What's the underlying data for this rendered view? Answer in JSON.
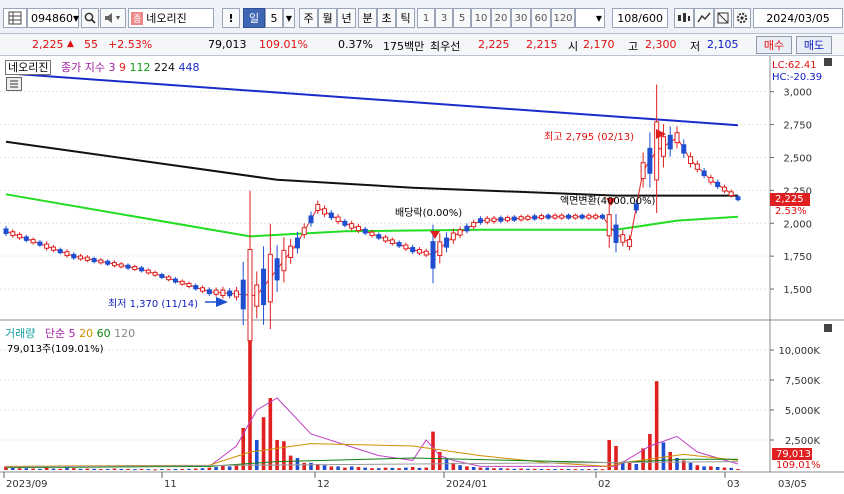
{
  "toolbar": {
    "code": "094860",
    "stock_name": "네오리진",
    "interval_buttons": [
      "일",
      "5",
      "주",
      "월",
      "년",
      "분",
      "초",
      "틱"
    ],
    "period_buttons": [
      "1",
      "3",
      "5",
      "10",
      "20",
      "30",
      "60",
      "120"
    ],
    "count": "108/600",
    "date": "2024/03/05"
  },
  "quote": {
    "price": "2,225",
    "change": "55",
    "change_pct": "+2.53%",
    "volume": "79,013",
    "volume_ratio": "109.01%",
    "turnover": "0.37%",
    "value_label": "175백만",
    "best_ask_label": "최우선",
    "best_ask": "2,225",
    "best_bid": "2,215",
    "open_label": "시",
    "open": "2,170",
    "high_label": "고",
    "high": "2,300",
    "low_label": "저",
    "low": "2,105",
    "buy_label": "매수",
    "sell_label": "매도"
  },
  "price_panel": {
    "name_tag": "네오리진",
    "ma_title": "종가 지수 3",
    "ma_periods": [
      "9",
      "112",
      "224",
      "448"
    ],
    "lc_label": "LC:62.41",
    "hc_label": "HC:-20.39",
    "high_note": "최고 2,795 (02/13)",
    "low_note": "최저 1,370 (11/14)",
    "dividend_note": "배당락(0.00%)",
    "par_change_note": "액면변환(4000.00%)",
    "current_price": "2,225",
    "current_pct": "2.53%"
  },
  "volume_panel": {
    "title": "거래량",
    "ma_title": "단순 5",
    "ma_periods": [
      "20",
      "60",
      "120"
    ],
    "volume_note": "79,013주(109.01%)",
    "current_volume": "79,013",
    "current_pct": "109.01%"
  },
  "colors": {
    "up": "#e02020",
    "down": "#1f4fd0",
    "ma9": "#e02020",
    "ma112": "#22dd22",
    "ma224": "#111111",
    "ma448": "#1a2cc8",
    "accent": "#3f66b3"
  },
  "chart_data": [
    {
      "type": "candlestick",
      "y_axis_ticks": [
        "3,000",
        "2,750",
        "2,500",
        "2,250",
        "2,000",
        "1,750",
        "1,500"
      ],
      "ylim": [
        1280,
        3180
      ],
      "grid": true,
      "x_axis_labels": [
        "2023/09",
        "11",
        "12",
        "2024/01",
        "02",
        "03",
        "03/05"
      ],
      "series": [
        {
          "name": "448",
          "x": [
            0,
            108
          ],
          "values": [
            3140,
            2745
          ]
        },
        {
          "name": "224",
          "x": [
            0,
            40,
            60,
            90,
            108
          ],
          "values": [
            2620,
            2330,
            2270,
            2210,
            2210
          ]
        },
        {
          "name": "112",
          "x": [
            0,
            36,
            50,
            70,
            90,
            99,
            108
          ],
          "values": [
            2220,
            1900,
            1940,
            1950,
            1950,
            2020,
            2050
          ]
        },
        {
          "name": "9",
          "x": [
            0,
            10,
            20,
            30,
            37,
            40,
            43,
            46,
            50,
            55,
            60,
            63,
            66,
            70,
            80,
            88,
            90,
            92,
            94,
            96,
            99,
            101,
            104,
            108
          ],
          "values": [
            1940,
            1750,
            1650,
            1480,
            1450,
            1650,
            1850,
            2120,
            2000,
            1900,
            1800,
            1760,
            1900,
            2020,
            2050,
            2050,
            1920,
            1850,
            2400,
            2550,
            2650,
            2480,
            2330,
            2190
          ]
        }
      ]
    },
    {
      "type": "bar",
      "y_axis_ticks": [
        "10,000K",
        "7,500K",
        "5,000K",
        "2,500K"
      ],
      "ylim": [
        0,
        11000000
      ],
      "grid": true,
      "categories": [
        0,
        1,
        2,
        3,
        4,
        5,
        6,
        7,
        8,
        9,
        10,
        11,
        12,
        13,
        14,
        15,
        16,
        17,
        18,
        19,
        20,
        21,
        22,
        23,
        24,
        25,
        26,
        27,
        28,
        29,
        30,
        31,
        32,
        33,
        34,
        35,
        36,
        37,
        38,
        39,
        40,
        41,
        42,
        43,
        44,
        45,
        46,
        47,
        48,
        49,
        50,
        51,
        52,
        53,
        54,
        55,
        56,
        57,
        58,
        59,
        60,
        61,
        62,
        63,
        64,
        65,
        66,
        67,
        68,
        69,
        70,
        71,
        72,
        73,
        74,
        75,
        76,
        77,
        78,
        79,
        80,
        81,
        82,
        83,
        84,
        85,
        86,
        87,
        88,
        89,
        90,
        91,
        92,
        93,
        94,
        95,
        96,
        97,
        98,
        99,
        100,
        101,
        102,
        103,
        104,
        105,
        106,
        107
      ],
      "values": [
        300000,
        200000,
        150000,
        150000,
        120000,
        100000,
        250000,
        120000,
        100000,
        200000,
        150000,
        100000,
        120000,
        100000,
        80000,
        90000,
        120000,
        90000,
        80000,
        70000,
        90000,
        70000,
        60000,
        80000,
        70000,
        90000,
        80000,
        100000,
        120000,
        150000,
        200000,
        250000,
        400000,
        300000,
        500000,
        3500000,
        11800000,
        2500000,
        4400000,
        6000000,
        2500000,
        2400000,
        1200000,
        1000000,
        600000,
        600000,
        500000,
        400000,
        300000,
        300000,
        200000,
        300000,
        250000,
        200000,
        150000,
        150000,
        200000,
        180000,
        150000,
        200000,
        250000,
        180000,
        200000,
        3200000,
        1500000,
        900000,
        600000,
        400000,
        300000,
        250000,
        200000,
        200000,
        150000,
        150000,
        120000,
        100000,
        120000,
        100000,
        100000,
        80000,
        80000,
        80000,
        80000,
        80000,
        70000,
        70000,
        80000,
        70000,
        70000,
        2500000,
        2000000,
        700000,
        600000,
        500000,
        1800000,
        3000000,
        7400000,
        2300000,
        1500000,
        1000000,
        800000,
        600000,
        400000,
        300000,
        300000,
        250000,
        200000,
        180000,
        79013
      ],
      "series": [
        {
          "name": "5",
          "x": [
            30,
            34,
            37,
            40,
            45,
            55,
            60,
            62,
            64,
            66,
            70,
            90,
            95,
            99,
            102,
            108
          ],
          "values": [
            300000,
            2000000,
            5000000,
            6000000,
            3000000,
            1200000,
            800000,
            2500000,
            1200000,
            800000,
            300000,
            300000,
            2000000,
            2800000,
            1500000,
            500000
          ]
        },
        {
          "name": "20",
          "x": [
            0,
            30,
            36,
            45,
            60,
            70,
            80,
            89,
            91,
            100,
            108
          ],
          "values": [
            300000,
            400000,
            1500000,
            2200000,
            2000000,
            1200000,
            600000,
            300000,
            600000,
            1300000,
            800000
          ]
        },
        {
          "name": "60",
          "x": [
            0,
            30,
            40,
            60,
            90,
            100,
            108
          ],
          "values": [
            200000,
            300000,
            700000,
            1000000,
            600000,
            900000,
            900000
          ]
        },
        {
          "name": "120",
          "x": [
            0,
            108
          ],
          "values": [
            250000,
            700000
          ]
        }
      ]
    }
  ]
}
